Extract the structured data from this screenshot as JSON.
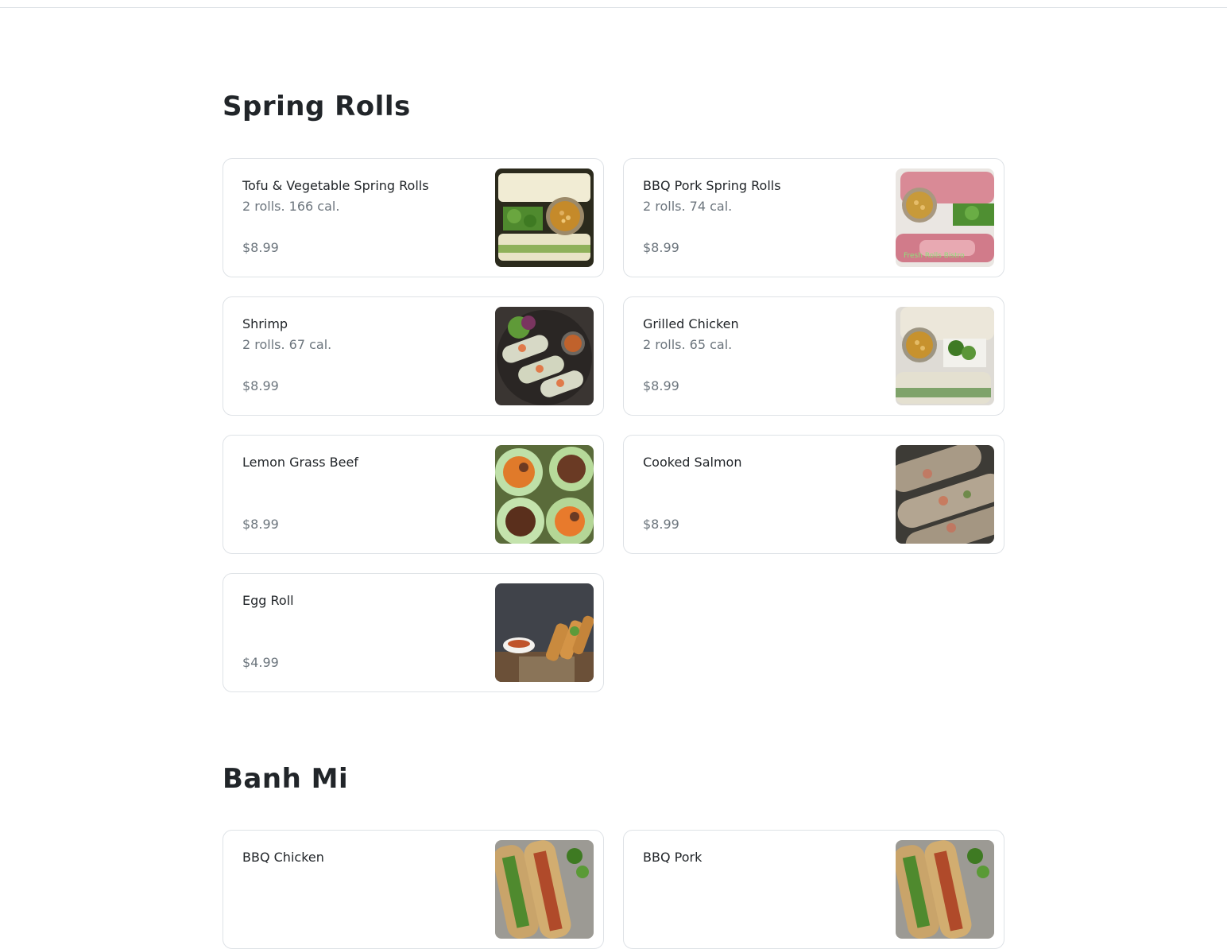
{
  "sections": [
    {
      "title": "Spring Rolls",
      "items": [
        {
          "name": "Tofu & Vegetable Spring Rolls",
          "desc": "2 rolls. 166 cal.",
          "price": "$8.99",
          "image": "tofu-vegetable-spring-rolls-photo"
        },
        {
          "name": "BBQ Pork Spring Rolls",
          "desc": "2 rolls. 74 cal.",
          "price": "$8.99",
          "image": "bbq-pork-spring-rolls-photo",
          "watermark": "Fresh Rolls Bistro"
        },
        {
          "name": "Shrimp",
          "desc": "2 rolls. 67 cal.",
          "price": "$8.99",
          "image": "shrimp-spring-rolls-photo"
        },
        {
          "name": "Grilled Chicken",
          "desc": "2 rolls. 65 cal.",
          "price": "$8.99",
          "image": "grilled-chicken-spring-rolls-photo"
        },
        {
          "name": "Lemon Grass Beef",
          "desc": "",
          "price": "$8.99",
          "image": "lemon-grass-beef-rolls-photo"
        },
        {
          "name": "Cooked Salmon",
          "desc": "",
          "price": "$8.99",
          "image": "cooked-salmon-rolls-photo"
        },
        {
          "name": "Egg Roll",
          "desc": "",
          "price": "$4.99",
          "image": "egg-roll-photo"
        }
      ]
    },
    {
      "title": "Banh Mi",
      "items": [
        {
          "name": "BBQ Chicken",
          "desc": "",
          "price": "",
          "image": "bbq-chicken-banh-mi-photo"
        },
        {
          "name": "BBQ Pork",
          "desc": "",
          "price": "",
          "image": "bbq-pork-banh-mi-photo"
        }
      ]
    }
  ]
}
